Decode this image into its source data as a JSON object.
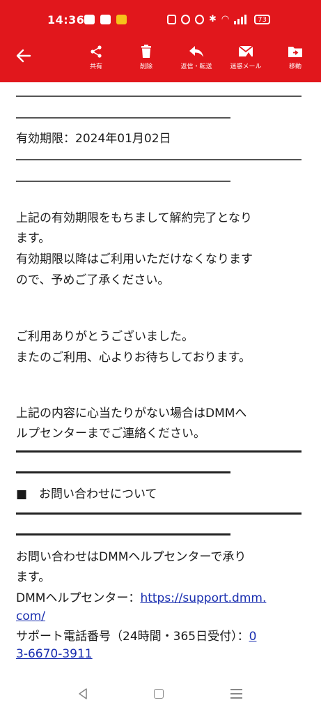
{
  "status_bar": {
    "time": "14:36",
    "battery": "73"
  },
  "toolbar": {
    "back_icon": "arrow-left-icon",
    "items": [
      {
        "label": "共有",
        "icon": "share-icon"
      },
      {
        "label": "削除",
        "icon": "trash-icon"
      },
      {
        "label": "返信・転送",
        "icon": "reply-icon"
      },
      {
        "label": "迷惑メール",
        "icon": "spam-mail-icon"
      },
      {
        "label": "移動",
        "icon": "move-folder-icon"
      }
    ]
  },
  "email": {
    "expiry_label": "有効期限：2024年01月02日",
    "body_1_line1": "上記の有効期限をもちまして解約完了となり",
    "body_1_line2": "ます。",
    "body_1_line3": "有効期限以降はご利用いただけなくなります",
    "body_1_line4": "ので、予めご了承ください。",
    "thanks_line1": "ご利用ありがとうございました。",
    "thanks_line2": "またのご利用、心よりお待ちしております。",
    "help_line1": "上記の内容に心当たりがない場合はDMMへ",
    "help_line2": "ルプセンターまでご連絡ください。",
    "section_title": "■　お問い合わせについて",
    "contact_line1": "お問い合わせはDMMヘルプセンターで承り",
    "contact_line2": "ます。",
    "help_center_label": "DMMヘルプセンター：",
    "help_center_url_part1": "https://support.dmm.",
    "help_center_url_part2": "com/",
    "phone_label": "サポート電話番号（24時間・365日受付）：",
    "phone_part1": "0",
    "phone_part2": "3-6670-3911"
  },
  "colors": {
    "brand_red": "#e1171c",
    "link_blue": "#1a2fb0"
  }
}
